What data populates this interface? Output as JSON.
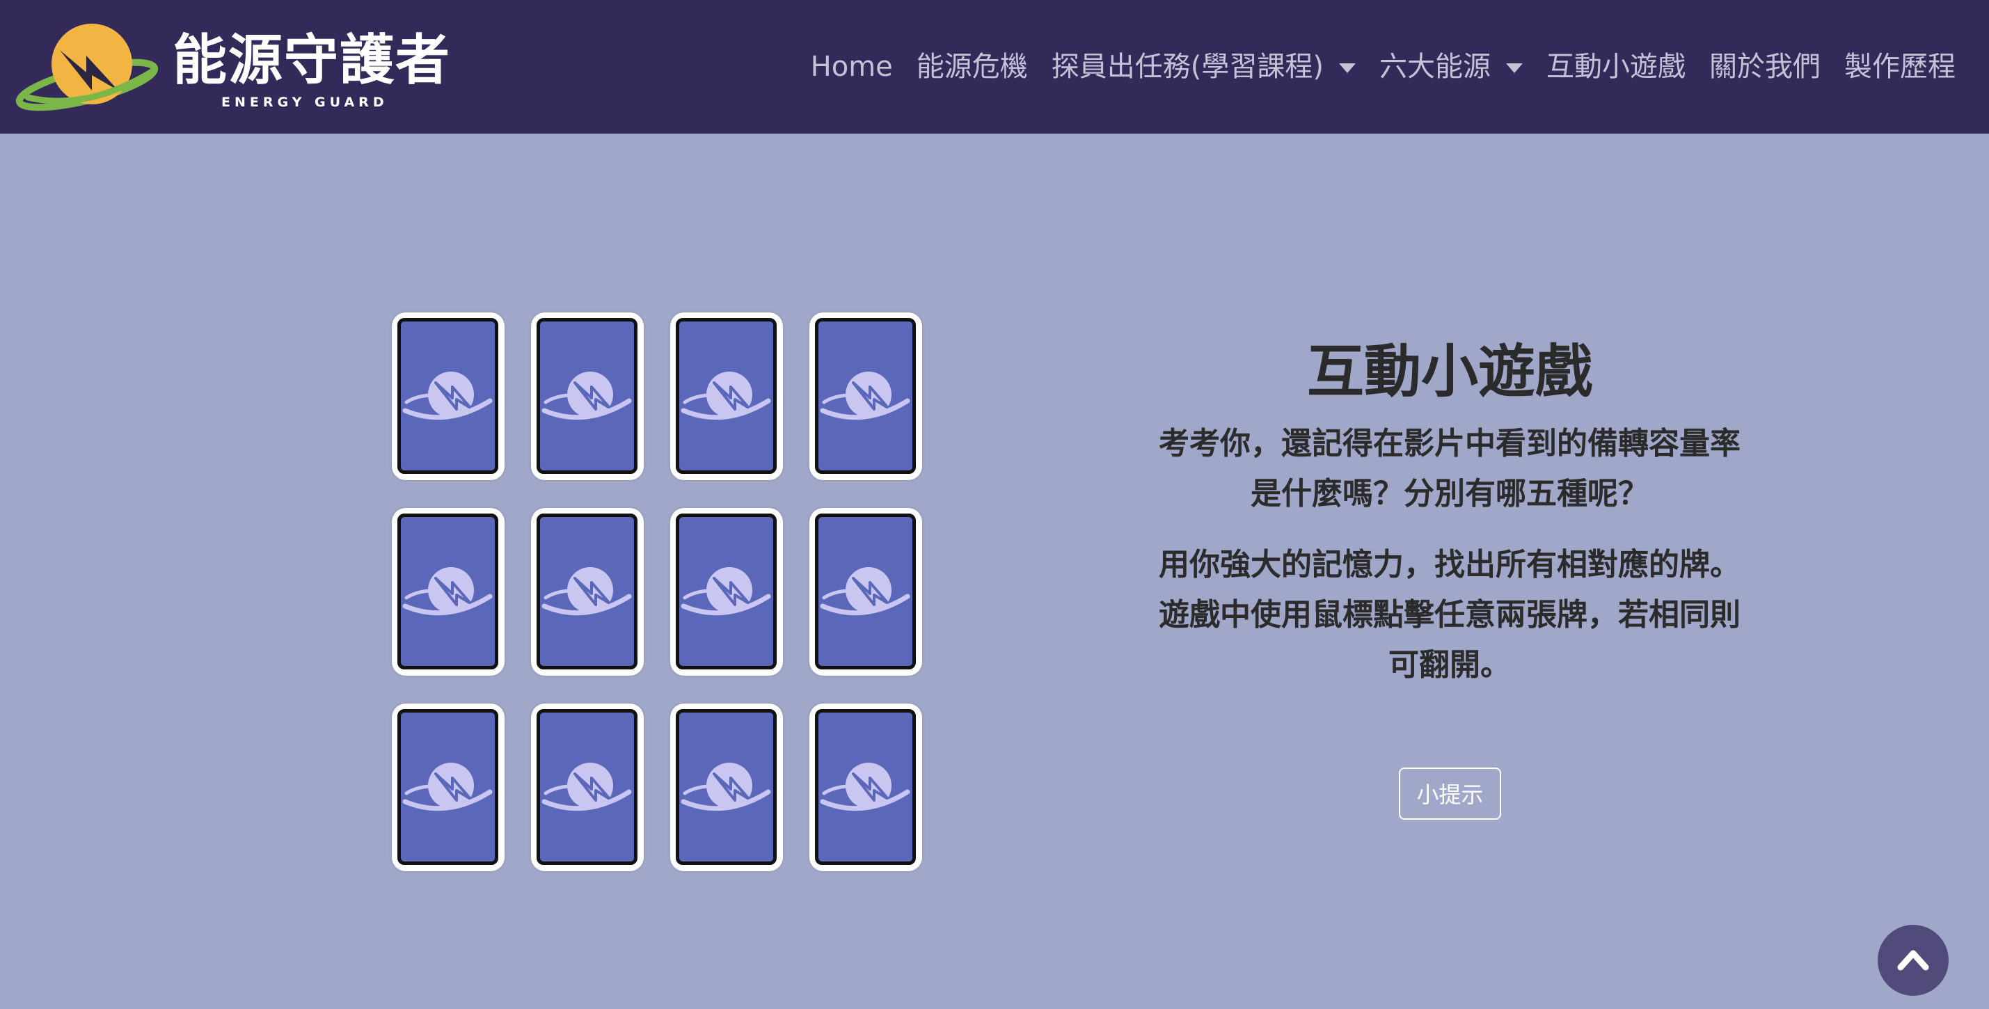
{
  "brand": {
    "title": "能源守護者",
    "subtitle": "ENERGY GUARD",
    "logo_icon": "lightning-sun-logo-icon"
  },
  "nav": {
    "items": [
      {
        "label": "Home",
        "dropdown": false
      },
      {
        "label": "能源危機",
        "dropdown": false
      },
      {
        "label": "探員出任務(學習課程)",
        "dropdown": true
      },
      {
        "label": "六大能源",
        "dropdown": true
      },
      {
        "label": "互動小遊戲",
        "dropdown": false
      },
      {
        "label": "關於我們",
        "dropdown": false
      },
      {
        "label": "製作歷程",
        "dropdown": false
      }
    ]
  },
  "game": {
    "rows": 3,
    "cols": 4,
    "card_state": "face-down",
    "card_back_icon": "lightning-logo-icon"
  },
  "intro": {
    "title": "互動小遊戲",
    "paragraph1": "考考你，還記得在影片中看到的備轉容量率是什麼嗎？分別有哪五種呢？",
    "paragraph2": "用你強大的記憶力，找出所有相對應的牌。遊戲中使用鼠標點擊任意兩張牌，若相同則可翻開。",
    "hint_button": "小提示"
  },
  "back_to_top": {
    "icon": "chevron-up-icon"
  },
  "colors": {
    "navbar": "#332a5a",
    "page_background": "#a0a7c9",
    "card_back": "#5b68b9",
    "nav_text": "#c3c3d7",
    "back_to_top": "#514b7b"
  }
}
